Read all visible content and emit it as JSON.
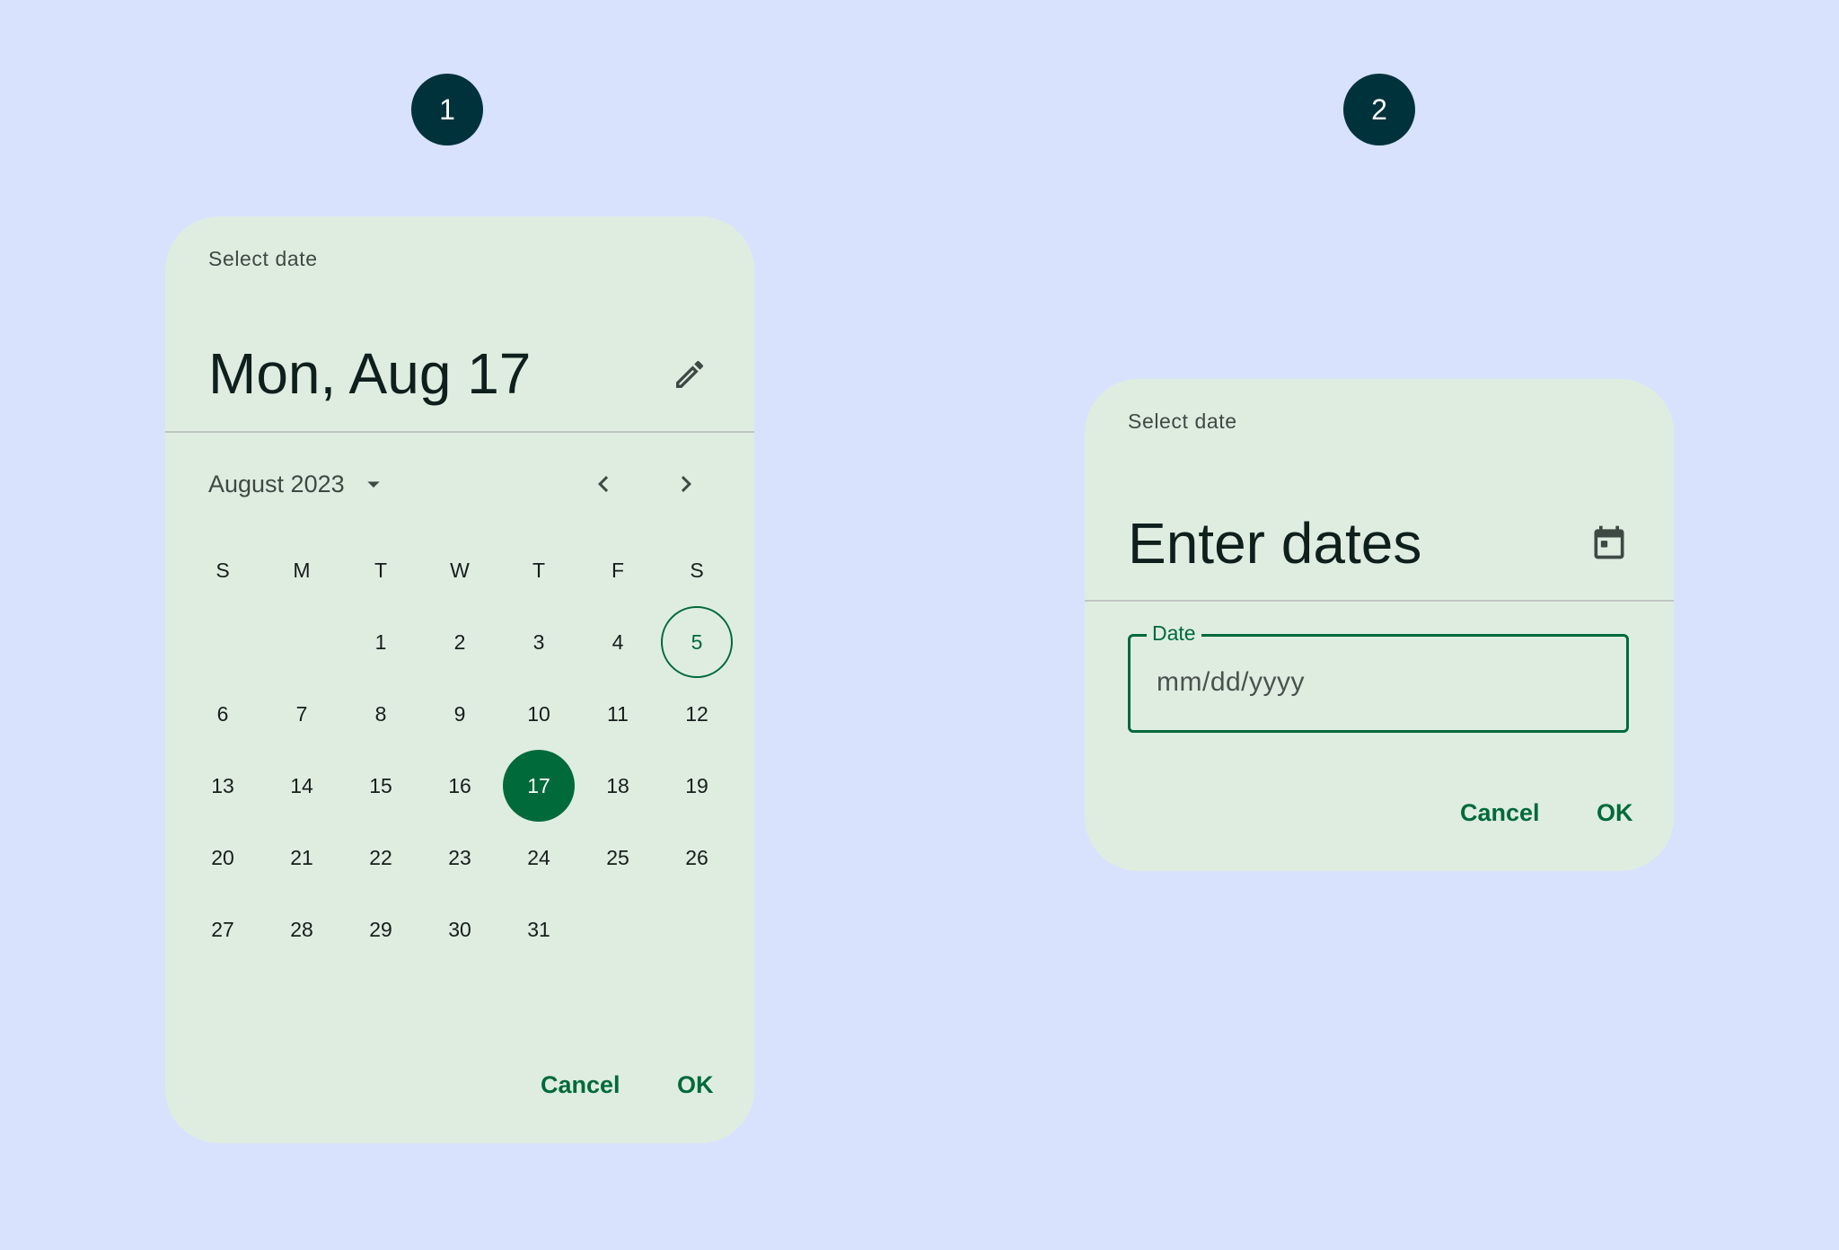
{
  "badges": [
    {
      "label": "1"
    },
    {
      "label": "2"
    }
  ],
  "picker1": {
    "title": "Select date",
    "headline": "Mon, Aug 17",
    "edit_icon": "pencil-icon",
    "month_label": "August 2023",
    "weekdays": [
      "S",
      "M",
      "T",
      "W",
      "T",
      "F",
      "S"
    ],
    "weeks": [
      [
        "",
        "",
        "1",
        "2",
        "3",
        "4",
        "5"
      ],
      [
        "6",
        "7",
        "8",
        "9",
        "10",
        "11",
        "12"
      ],
      [
        "13",
        "14",
        "15",
        "16",
        "17",
        "18",
        "19"
      ],
      [
        "20",
        "21",
        "22",
        "23",
        "24",
        "25",
        "26"
      ],
      [
        "27",
        "28",
        "29",
        "30",
        "31",
        "",
        ""
      ]
    ],
    "today": "5",
    "selected": "17",
    "cancel_label": "Cancel",
    "ok_label": "OK"
  },
  "picker2": {
    "title": "Select date",
    "headline": "Enter dates",
    "calendar_icon": "calendar-icon",
    "field_label": "Date",
    "field_placeholder": "mm/dd/yyyy",
    "cancel_label": "Cancel",
    "ok_label": "OK"
  },
  "colors": {
    "background": "#d8e2fd",
    "surface": "#dfede1",
    "primary": "#006a3a",
    "badge": "#00323c"
  }
}
